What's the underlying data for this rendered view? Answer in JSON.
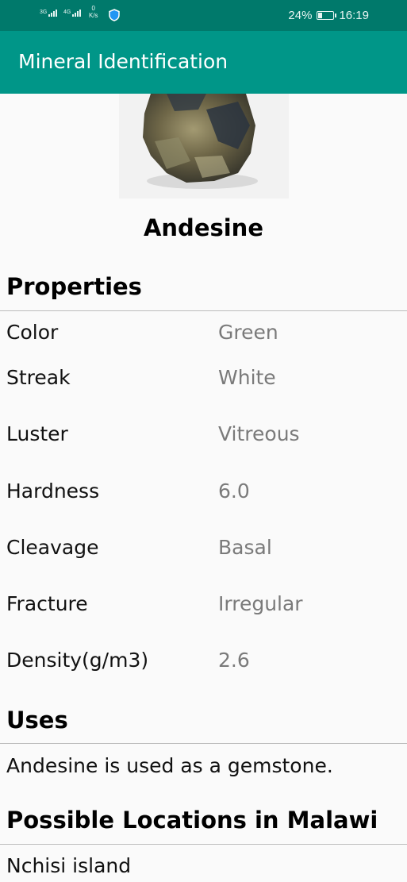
{
  "status_bar": {
    "network_up": "0",
    "network_unit": "K/s",
    "battery_percent": "24%",
    "battery_level": 0.24,
    "time": "16:19",
    "signal_tags": [
      "3G",
      "4G"
    ]
  },
  "app_bar": {
    "title": "Mineral Identification"
  },
  "mineral": {
    "name": "Andesine"
  },
  "sections": {
    "properties": "Properties",
    "uses": "Uses",
    "locations": "Possible Locations in Malawi"
  },
  "properties": [
    {
      "label": "Color",
      "value": "Green"
    },
    {
      "label": "Streak",
      "value": "White"
    },
    {
      "label": "Luster",
      "value": "Vitreous"
    },
    {
      "label": "Hardness",
      "value": "6.0"
    },
    {
      "label": "Cleavage",
      "value": "Basal"
    },
    {
      "label": "Fracture",
      "value": "Irregular"
    },
    {
      "label": "Density(g/m3)",
      "value": "2.6"
    }
  ],
  "uses_text": "Andesine is used as a gemstone.",
  "locations_text": "Nchisi island",
  "colors": {
    "status_bar": "#00796b",
    "app_bar": "#009688",
    "background": "#fafafa",
    "value_text": "#7a7a7a"
  }
}
